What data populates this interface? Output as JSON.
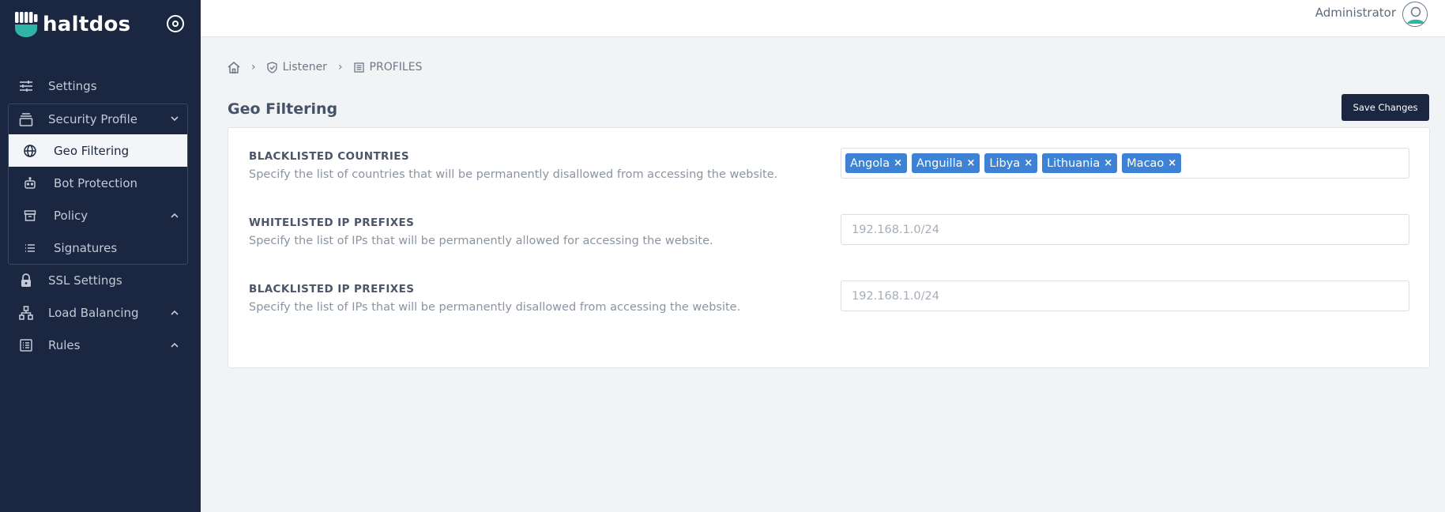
{
  "brand": {
    "name": "haltdos"
  },
  "sidebar": {
    "items": [
      {
        "label": "Settings",
        "icon": "sliders-icon"
      },
      {
        "label": "Security Profile",
        "icon": "layers-icon"
      },
      {
        "label": "SSL Settings",
        "icon": "lock-icon"
      },
      {
        "label": "Load Balancing",
        "icon": "hierarchy-icon"
      },
      {
        "label": "Rules",
        "icon": "list-box-icon"
      }
    ],
    "sub_items": [
      {
        "label": "Geo Filtering",
        "icon": "globe-icon",
        "active": true
      },
      {
        "label": "Bot Protection",
        "icon": "robot-icon"
      },
      {
        "label": "Policy",
        "icon": "archive-icon"
      },
      {
        "label": "Signatures",
        "icon": "list-icon"
      }
    ]
  },
  "header": {
    "user": "Administrator"
  },
  "breadcrumb": {
    "items": [
      "Listener",
      "PROFILES"
    ]
  },
  "page": {
    "title": "Geo Filtering",
    "save_label": "Save Changes"
  },
  "fields": [
    {
      "title": "BLACKLISTED COUNTRIES",
      "description": "Specify the list of countries that will be permanently disallowed from accessing the website.",
      "tags": [
        "Angola",
        "Anguilla",
        "Libya",
        "Lithuania",
        "Macao"
      ]
    },
    {
      "title": "WHITELISTED IP PREFIXES",
      "description": "Specify the list of IPs that will be permanently allowed for accessing the website.",
      "placeholder": "192.168.1.0/24"
    },
    {
      "title": "BLACKLISTED IP PREFIXES",
      "description": "Specify the list of IPs that will be permanently disallowed from accessing the website.",
      "placeholder": "192.168.1.0/24"
    }
  ],
  "colors": {
    "sidebar": "#1b2640",
    "accent": "#3d82d4",
    "brand_logo": "#2fb5a5"
  }
}
